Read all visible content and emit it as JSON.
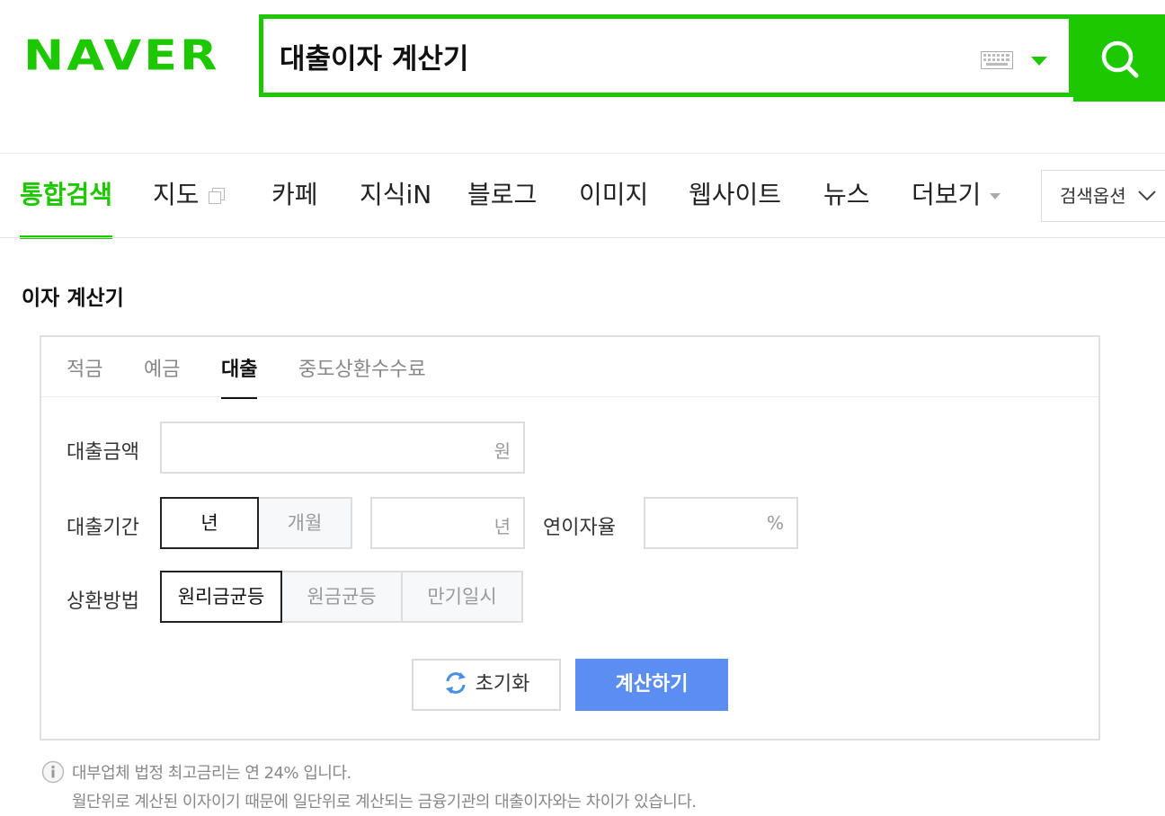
{
  "header": {
    "logo": "NAVER",
    "search_query": "대출이자 계산기",
    "keyboard_icon": "keyboard-icon",
    "dropdown_icon": "caret-down-icon",
    "search_icon": "search-icon",
    "brand_color": "#1ec800"
  },
  "nav": {
    "tabs": [
      {
        "label": "통합검색",
        "active": true
      },
      {
        "label": "지도",
        "active": false
      },
      {
        "label": "카페",
        "active": false
      },
      {
        "label": "지식iN",
        "active": false
      },
      {
        "label": "블로그",
        "active": false
      },
      {
        "label": "이미지",
        "active": false
      },
      {
        "label": "웹사이트",
        "active": false
      },
      {
        "label": "뉴스",
        "active": false
      },
      {
        "label": "더보기",
        "active": false
      }
    ],
    "options_label": "검색옵션"
  },
  "calculator": {
    "title": "이자 계산기",
    "tabs": [
      {
        "label": "적금",
        "active": false
      },
      {
        "label": "예금",
        "active": false
      },
      {
        "label": "대출",
        "active": true
      },
      {
        "label": "중도상환수수료",
        "active": false
      }
    ],
    "loan_amount": {
      "label": "대출금액",
      "value": "",
      "unit": "원"
    },
    "loan_period": {
      "label": "대출기간",
      "options": [
        {
          "label": "년",
          "selected": true
        },
        {
          "label": "개월",
          "selected": false
        }
      ],
      "value": "",
      "unit": "년"
    },
    "interest_rate": {
      "label": "연이자율",
      "value": "",
      "unit": "%"
    },
    "repayment": {
      "label": "상환방법",
      "options": [
        {
          "label": "원리금균등",
          "selected": true
        },
        {
          "label": "원금균등",
          "selected": false
        },
        {
          "label": "만기일시",
          "selected": false
        }
      ]
    },
    "reset_label": "초기화",
    "calculate_label": "계산하기",
    "calculate_color": "#5b8ef0"
  },
  "notes": [
    "대부업체 법정 최고금리는 연 24% 입니다.",
    "월단위로 계산된 이자이기 때문에 일단위로 계산되는 금융기관의 대출이자와는 차이가 있습니다."
  ]
}
